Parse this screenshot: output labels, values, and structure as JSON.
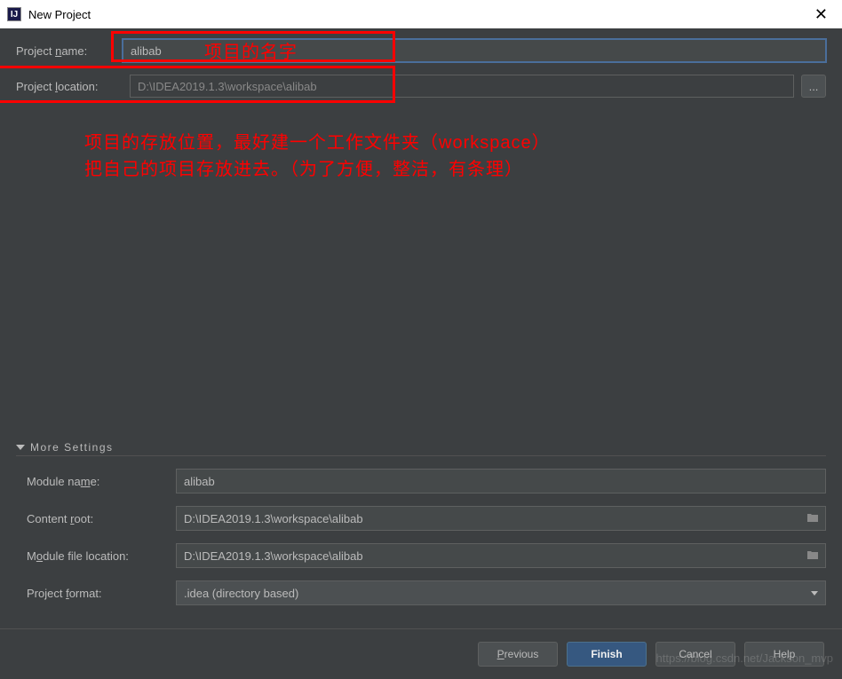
{
  "window": {
    "title": "New Project",
    "icon_letter": "IJ"
  },
  "form": {
    "project_name_label": "Project name:",
    "project_name_value": "alibab",
    "project_location_label": "Project location:",
    "project_location_value": "D:\\IDEA2019.1.3\\workspace\\alibab",
    "browse_label": "..."
  },
  "annotations": {
    "name_note": "项目的名字",
    "location_note_line1": "项目的存放位置，最好建一个工作文件夹（workspace）",
    "location_note_line2": "把自己的项目存放进去。（为了方便，整洁，有条理）"
  },
  "more_settings": {
    "header": "More Settings",
    "module_name_label": "Module name:",
    "module_name_value": "alibab",
    "content_root_label": "Content root:",
    "content_root_value": "D:\\IDEA2019.1.3\\workspace\\alibab",
    "module_file_location_label": "Module file location:",
    "module_file_location_value": "D:\\IDEA2019.1.3\\workspace\\alibab",
    "project_format_label": "Project format:",
    "project_format_value": ".idea (directory based)"
  },
  "buttons": {
    "previous": "Previous",
    "finish": "Finish",
    "cancel": "Cancel",
    "help": "Help"
  },
  "watermark": "https://blog.csdn.net/Jackson_mvp"
}
